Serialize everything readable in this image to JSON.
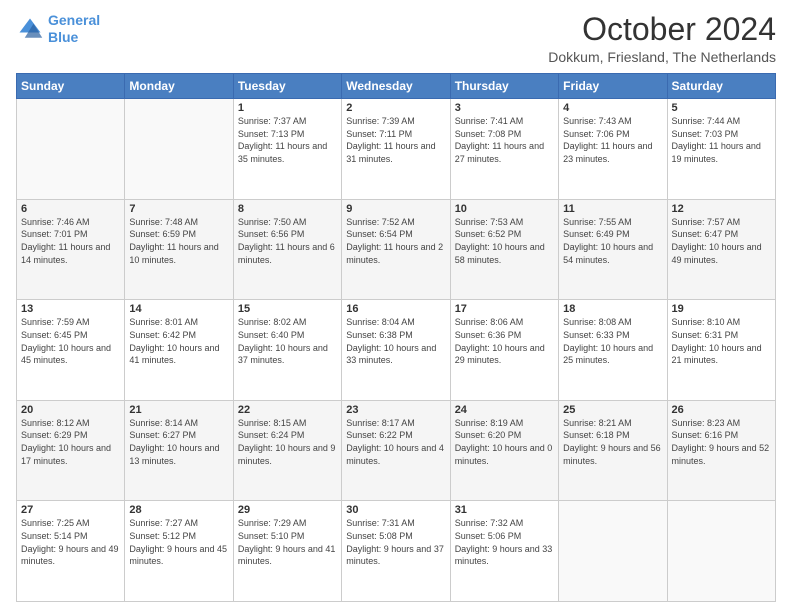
{
  "header": {
    "logo_line1": "General",
    "logo_line2": "Blue",
    "title": "October 2024",
    "subtitle": "Dokkum, Friesland, The Netherlands"
  },
  "days_of_week": [
    "Sunday",
    "Monday",
    "Tuesday",
    "Wednesday",
    "Thursday",
    "Friday",
    "Saturday"
  ],
  "weeks": [
    [
      {
        "num": "",
        "info": ""
      },
      {
        "num": "",
        "info": ""
      },
      {
        "num": "1",
        "info": "Sunrise: 7:37 AM\nSunset: 7:13 PM\nDaylight: 11 hours and 35 minutes."
      },
      {
        "num": "2",
        "info": "Sunrise: 7:39 AM\nSunset: 7:11 PM\nDaylight: 11 hours and 31 minutes."
      },
      {
        "num": "3",
        "info": "Sunrise: 7:41 AM\nSunset: 7:08 PM\nDaylight: 11 hours and 27 minutes."
      },
      {
        "num": "4",
        "info": "Sunrise: 7:43 AM\nSunset: 7:06 PM\nDaylight: 11 hours and 23 minutes."
      },
      {
        "num": "5",
        "info": "Sunrise: 7:44 AM\nSunset: 7:03 PM\nDaylight: 11 hours and 19 minutes."
      }
    ],
    [
      {
        "num": "6",
        "info": "Sunrise: 7:46 AM\nSunset: 7:01 PM\nDaylight: 11 hours and 14 minutes."
      },
      {
        "num": "7",
        "info": "Sunrise: 7:48 AM\nSunset: 6:59 PM\nDaylight: 11 hours and 10 minutes."
      },
      {
        "num": "8",
        "info": "Sunrise: 7:50 AM\nSunset: 6:56 PM\nDaylight: 11 hours and 6 minutes."
      },
      {
        "num": "9",
        "info": "Sunrise: 7:52 AM\nSunset: 6:54 PM\nDaylight: 11 hours and 2 minutes."
      },
      {
        "num": "10",
        "info": "Sunrise: 7:53 AM\nSunset: 6:52 PM\nDaylight: 10 hours and 58 minutes."
      },
      {
        "num": "11",
        "info": "Sunrise: 7:55 AM\nSunset: 6:49 PM\nDaylight: 10 hours and 54 minutes."
      },
      {
        "num": "12",
        "info": "Sunrise: 7:57 AM\nSunset: 6:47 PM\nDaylight: 10 hours and 49 minutes."
      }
    ],
    [
      {
        "num": "13",
        "info": "Sunrise: 7:59 AM\nSunset: 6:45 PM\nDaylight: 10 hours and 45 minutes."
      },
      {
        "num": "14",
        "info": "Sunrise: 8:01 AM\nSunset: 6:42 PM\nDaylight: 10 hours and 41 minutes."
      },
      {
        "num": "15",
        "info": "Sunrise: 8:02 AM\nSunset: 6:40 PM\nDaylight: 10 hours and 37 minutes."
      },
      {
        "num": "16",
        "info": "Sunrise: 8:04 AM\nSunset: 6:38 PM\nDaylight: 10 hours and 33 minutes."
      },
      {
        "num": "17",
        "info": "Sunrise: 8:06 AM\nSunset: 6:36 PM\nDaylight: 10 hours and 29 minutes."
      },
      {
        "num": "18",
        "info": "Sunrise: 8:08 AM\nSunset: 6:33 PM\nDaylight: 10 hours and 25 minutes."
      },
      {
        "num": "19",
        "info": "Sunrise: 8:10 AM\nSunset: 6:31 PM\nDaylight: 10 hours and 21 minutes."
      }
    ],
    [
      {
        "num": "20",
        "info": "Sunrise: 8:12 AM\nSunset: 6:29 PM\nDaylight: 10 hours and 17 minutes."
      },
      {
        "num": "21",
        "info": "Sunrise: 8:14 AM\nSunset: 6:27 PM\nDaylight: 10 hours and 13 minutes."
      },
      {
        "num": "22",
        "info": "Sunrise: 8:15 AM\nSunset: 6:24 PM\nDaylight: 10 hours and 9 minutes."
      },
      {
        "num": "23",
        "info": "Sunrise: 8:17 AM\nSunset: 6:22 PM\nDaylight: 10 hours and 4 minutes."
      },
      {
        "num": "24",
        "info": "Sunrise: 8:19 AM\nSunset: 6:20 PM\nDaylight: 10 hours and 0 minutes."
      },
      {
        "num": "25",
        "info": "Sunrise: 8:21 AM\nSunset: 6:18 PM\nDaylight: 9 hours and 56 minutes."
      },
      {
        "num": "26",
        "info": "Sunrise: 8:23 AM\nSunset: 6:16 PM\nDaylight: 9 hours and 52 minutes."
      }
    ],
    [
      {
        "num": "27",
        "info": "Sunrise: 7:25 AM\nSunset: 5:14 PM\nDaylight: 9 hours and 49 minutes."
      },
      {
        "num": "28",
        "info": "Sunrise: 7:27 AM\nSunset: 5:12 PM\nDaylight: 9 hours and 45 minutes."
      },
      {
        "num": "29",
        "info": "Sunrise: 7:29 AM\nSunset: 5:10 PM\nDaylight: 9 hours and 41 minutes."
      },
      {
        "num": "30",
        "info": "Sunrise: 7:31 AM\nSunset: 5:08 PM\nDaylight: 9 hours and 37 minutes."
      },
      {
        "num": "31",
        "info": "Sunrise: 7:32 AM\nSunset: 5:06 PM\nDaylight: 9 hours and 33 minutes."
      },
      {
        "num": "",
        "info": ""
      },
      {
        "num": "",
        "info": ""
      }
    ]
  ]
}
